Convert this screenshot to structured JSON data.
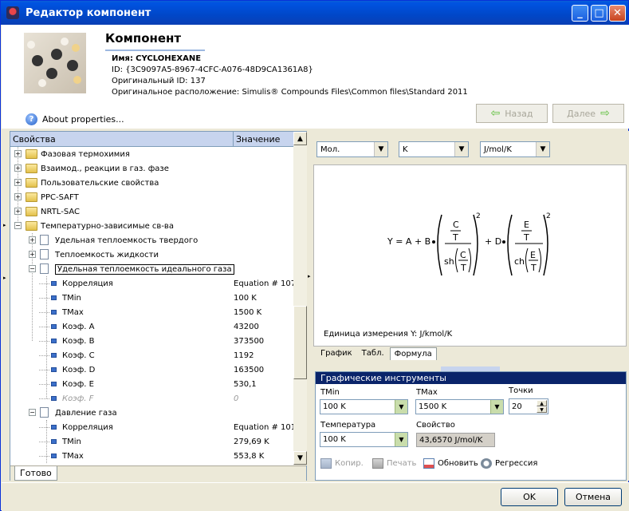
{
  "window": {
    "title": "Редактор компонент",
    "min": "_",
    "max": "□",
    "close": "✕"
  },
  "header": {
    "section_title": "Компонент",
    "name_label": "Имя:",
    "name_value": "CYCLOHEXANE",
    "id_line": "ID: {3C9097A5-8967-4CFC-A076-48D9CA1361A8}",
    "orig_id_line": "Оригинальный ID: 137",
    "location_line": "Оригинальное расположение: Simulis® Compounds Files\\Common files\\Standard 2011",
    "back_label": "Назад",
    "next_label": "Далее",
    "about_label": "About properties..."
  },
  "tree": {
    "col_property": "Свойства",
    "col_value": "Значение",
    "rows": [
      {
        "label": "Фазовая термохимия",
        "value": ""
      },
      {
        "label": "Взаимод., реакции в газ. фазе",
        "value": ""
      },
      {
        "label": "Пользовательские свойства",
        "value": ""
      },
      {
        "label": "PPC-SAFT",
        "value": ""
      },
      {
        "label": "NRTL-SAC",
        "value": ""
      },
      {
        "label": "Температурно-зависимые св-ва",
        "value": ""
      },
      {
        "label": "Удельная теплоемкость твердого",
        "value": ""
      },
      {
        "label": "Теплоемкость жидкости",
        "value": ""
      },
      {
        "label": "Удельная теплоемкость идеального газа",
        "value": ""
      },
      {
        "label": "Корреляция",
        "value": "Equation # 107"
      },
      {
        "label": "TMin",
        "value": "100 K"
      },
      {
        "label": "TMax",
        "value": "1500 K"
      },
      {
        "label": "Коэф. A",
        "value": "43200"
      },
      {
        "label": "Коэф. B",
        "value": "373500"
      },
      {
        "label": "Коэф. C",
        "value": "1192"
      },
      {
        "label": "Коэф. D",
        "value": "163500"
      },
      {
        "label": "Коэф. E",
        "value": "530,1"
      },
      {
        "label": "Коэф. F",
        "value": "0"
      },
      {
        "label": "Давление газа",
        "value": ""
      },
      {
        "label": "Корреляция",
        "value": "Equation # 101"
      },
      {
        "label": "TMin",
        "value": "279,69 K"
      },
      {
        "label": "TMax",
        "value": "553,8 K"
      }
    ],
    "status_tab": "Готово"
  },
  "units": {
    "basis": "Мол.",
    "temperature": "K",
    "heat_capacity": "J/mol/K"
  },
  "formula": {
    "lhs": "Y = A + B",
    "frac1_num": "C",
    "frac1_den_num": "C",
    "frac1_T": "T",
    "frac1_func": "sh",
    "plus_d": "+ D",
    "frac2_num": "E",
    "frac2_func": "ch",
    "frac2_den_num": "E",
    "exponent": "2",
    "unit_line": "Единица измерения Y: J/kmol/K"
  },
  "view_tabs": [
    "График",
    "Табл.",
    "Формула"
  ],
  "tools": {
    "title": "Графические инструменты",
    "tmin_label": "TMin",
    "tmin_value": "100 K",
    "tmax_label": "TMax",
    "tmax_value": "1500 K",
    "points_label": "Точки",
    "points_value": "20",
    "temp_label": "Температура",
    "temp_value": "100 K",
    "prop_label": "Свойство",
    "prop_value": "43,6570 J/mol/K",
    "copy_label": "Копир.",
    "print_label": "Печать",
    "refresh_label": "Обновить",
    "regress_label": "Регрессия"
  },
  "dialog": {
    "ok": "OK",
    "cancel": "Отмена"
  }
}
